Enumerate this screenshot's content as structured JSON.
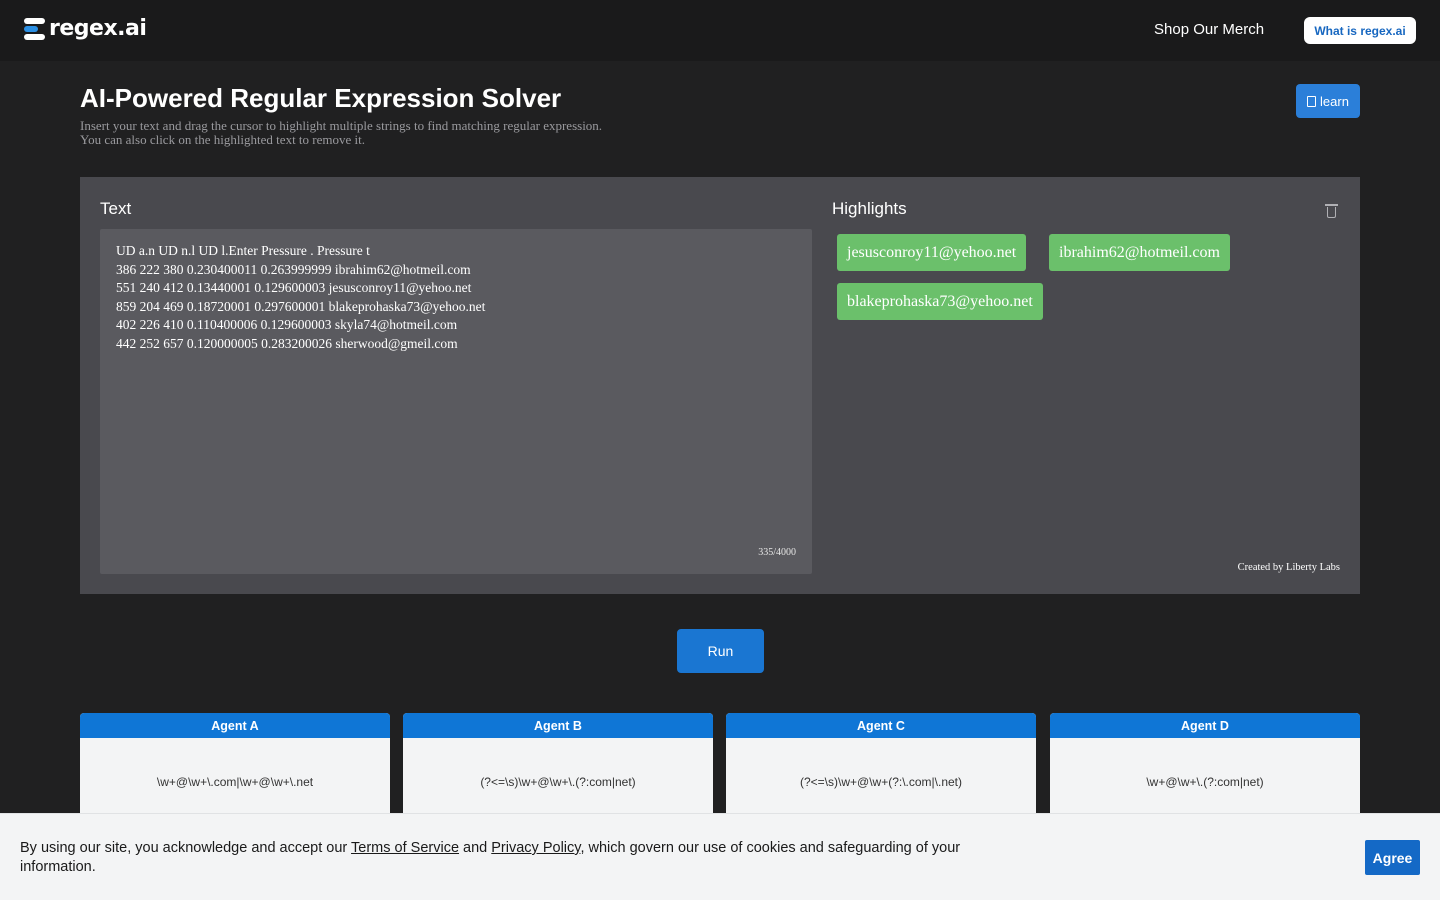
{
  "header": {
    "brand": "regex.ai",
    "merch_link": "Shop Our Merch",
    "what_button": "What is regex.ai"
  },
  "page": {
    "title": "AI-Powered Regular Expression Solver",
    "subtitle_line1": "Insert your text and drag the cursor to highlight multiple strings to find matching regular expression.",
    "subtitle_line2": "You can also click on the highlighted text to remove it.",
    "learn_button": "learn"
  },
  "text_panel": {
    "label": "Text",
    "lines": [
      "UD a.n UD n.l UD l.Enter Pressure . Pressure t",
      "386 222 380 0.230400011 0.263999999 ibrahim62@hotmeil.com",
      "551 240 412 0.13440001 0.129600003 jesusconroy11@yehoo.net",
      "859 204 469 0.18720001 0.297600001 blakeprohaska73@yehoo.net",
      "402 226 410 0.110400006 0.129600003 skyla74@hotmeil.com",
      "442 252 657 0.120000005 0.283200026 sherwood@gmeil.com"
    ],
    "counter": "335/4000"
  },
  "highlights": {
    "label": "Highlights",
    "chips": [
      "jesusconroy11@yehoo.net",
      "ibrahim62@hotmeil.com",
      "blakeprohaska73@yehoo.net"
    ],
    "credit": "Created by Liberty Labs"
  },
  "run_button": "Run",
  "agents": [
    {
      "name": "Agent A",
      "regex": "\\w+@\\w+\\.com|\\w+@\\w+\\.net"
    },
    {
      "name": "Agent B",
      "regex": "(?<=\\s)\\w+@\\w+\\.(?:com|net)"
    },
    {
      "name": "Agent C",
      "regex": "(?<=\\s)\\w+@\\w+(?:\\.com|\\.net)"
    },
    {
      "name": "Agent D",
      "regex": "\\w+@\\w+\\.(?:com|net)"
    }
  ],
  "cookie": {
    "text_before": "By using our site, you acknowledge and accept our ",
    "terms_link": "Terms of Service",
    "text_and": " and ",
    "privacy_link": "Privacy Policy",
    "text_after": ", which govern our use of cookies and safeguarding of your information.",
    "agree_button": "Agree"
  }
}
